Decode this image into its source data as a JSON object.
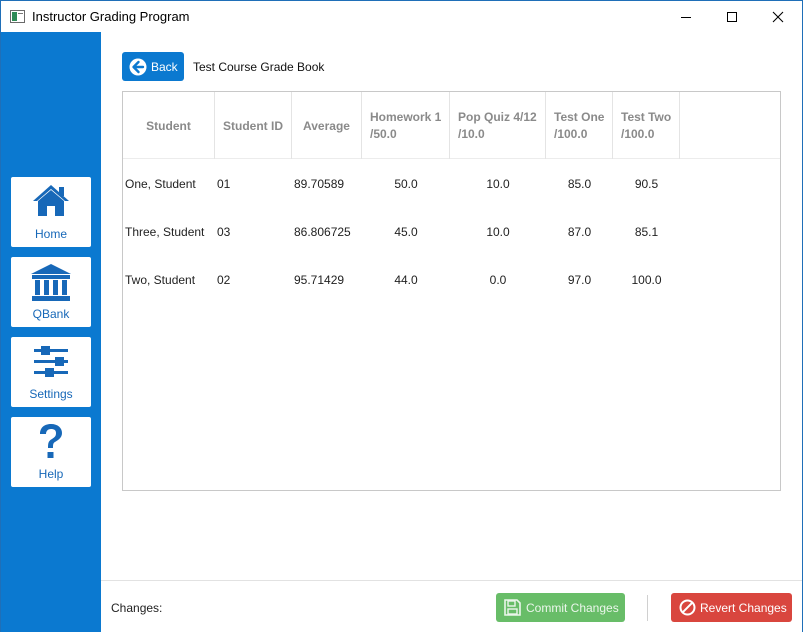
{
  "window": {
    "title": "Instructor Grading Program",
    "accent_color": "#0b79d0",
    "controls": {
      "minimize_icon": "minimize-icon",
      "maximize_icon": "maximize-icon",
      "close_icon": "close-icon"
    }
  },
  "sidebar": {
    "items": [
      {
        "label": "Home",
        "icon": "home-icon"
      },
      {
        "label": "QBank",
        "icon": "bank-icon"
      },
      {
        "label": "Settings",
        "icon": "sliders-icon"
      },
      {
        "label": "Help",
        "icon": "question-icon"
      }
    ]
  },
  "header": {
    "back_label": "Back",
    "title": "Test Course Grade Book"
  },
  "table": {
    "columns": [
      {
        "line1": "Student",
        "line2": ""
      },
      {
        "line1": "Student ID",
        "line2": ""
      },
      {
        "line1": "Average",
        "line2": ""
      },
      {
        "line1": "Homework 1",
        "line2": "/50.0"
      },
      {
        "line1": "Pop Quiz 4/12",
        "line2": "/10.0"
      },
      {
        "line1": "Test One",
        "line2": "/100.0"
      },
      {
        "line1": "Test Two",
        "line2": "/100.0"
      }
    ],
    "rows": [
      [
        "One, Student",
        "01",
        "89.70589",
        "50.0",
        "10.0",
        "85.0",
        "90.5"
      ],
      [
        "Three, Student",
        "03",
        "86.806725",
        "45.0",
        "10.0",
        "87.0",
        "85.1"
      ],
      [
        "Two, Student",
        "02",
        "95.71429",
        "44.0",
        "0.0",
        "97.0",
        "100.0"
      ]
    ]
  },
  "footer": {
    "changes_label": "Changes:",
    "commit_label": "Commit Changes",
    "revert_label": "Revert Changes",
    "commit_color": "#5cb85c",
    "revert_color": "#d9463e"
  }
}
